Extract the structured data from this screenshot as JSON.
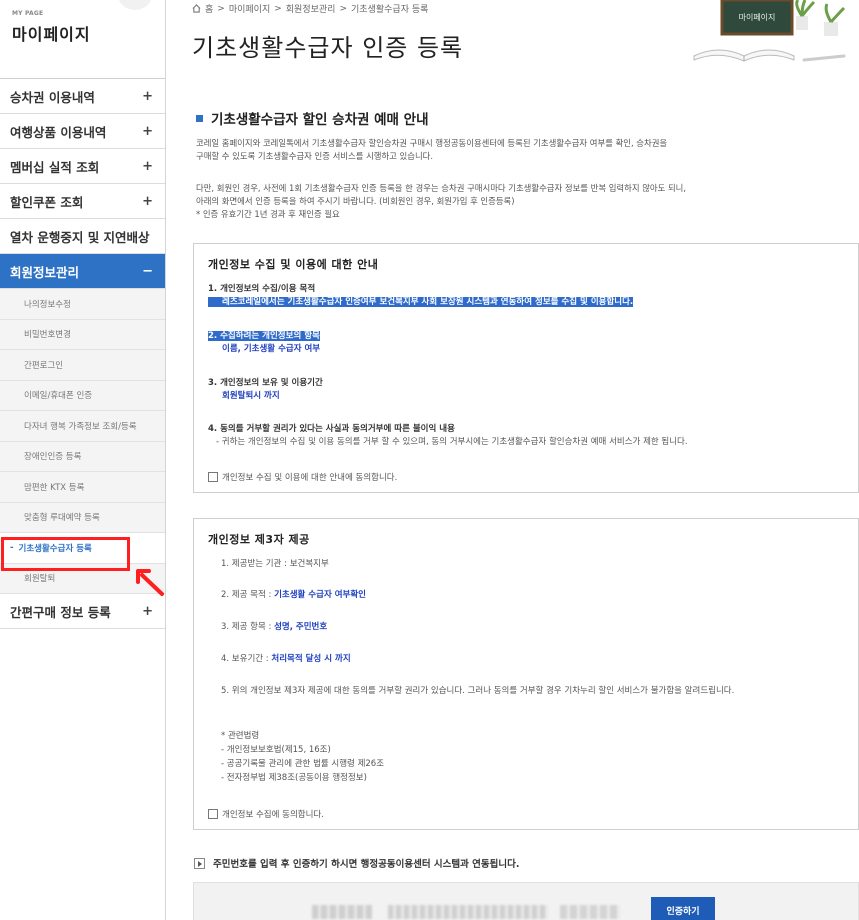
{
  "sidebar": {
    "sub": "MY PAGE",
    "title": "마이페이지",
    "menu": [
      {
        "label": "승차권 이용내역",
        "sign": "+"
      },
      {
        "label": "여행상품 이용내역",
        "sign": "+"
      },
      {
        "label": "멤버십 실적 조회",
        "sign": "+"
      },
      {
        "label": "할인쿠폰 조회",
        "sign": "+"
      },
      {
        "label": "열차 운행중지 및 지연배상",
        "sign": ""
      },
      {
        "label": "회원정보관리",
        "sign": "−"
      }
    ],
    "submenu": [
      "나의정보수정",
      "비밀번호변경",
      "간편로그인",
      "이메일/휴대폰 인증",
      "다자녀 행복 가족정보 조회/등록",
      "장애인인증 등록",
      "맘편한 KTX 등록",
      "맞춤형 루대예약 등록",
      "기초생활수급자 등록",
      "회원탈퇴"
    ],
    "current_dash": "-",
    "last_menu": {
      "label": "간편구매 정보 등록",
      "sign": "+"
    }
  },
  "breadcrumb": {
    "home_icon": "home-icon",
    "items": [
      "홈",
      ">",
      "마이페이지",
      ">",
      "회원정보관리",
      ">",
      "기초생활수급자 등록"
    ]
  },
  "page_title": "기초생활수급자 인증 등록",
  "deco_board_text": "마이페이지",
  "section": {
    "title": "기초생활수급자 할인 승차권 예매 안내",
    "intro_lines": [
      "코레일 홈페이지와 코레일톡에서 기초생활수급자 할인승차권 구매시 행정공동이용센터에 등록된 기초생활수급자 여부를 확인, 승차권을",
      "구매할 수 있도록 기초생활수급자 인증 서비스를 시행하고 있습니다.",
      "다만, 회원인 경우, 사전에 1회 기초생활수급자 인증 등록을 한 경우는 승차권 구매시마다 기초생활수급자 정보를 반복 입력하지 않아도 되니,",
      "아래의 화면에서 인증 등록을 하여 주시기 바랍니다. (비회원인 경우, 회원가입 후 인증등록)",
      "* 인증 유효기간 1년 경과 후 재인증 필요"
    ]
  },
  "box1": {
    "title": "개인정보 수집 및 이용에 대한 안내",
    "item1_h": "1. 개인정보의 수집/이용 목적",
    "item1_v": "레츠코레일에서는 기초생활수급자 인증여부 보건복지부 사회 보장원 시스템과 연동하여 정보를 수집 및 이용합니다.",
    "item2_h": "2. 수집하려는 개인정보의 항목",
    "item2_v": "이름, 기초생활 수급자 여부",
    "item3_h": "3. 개인정보의 보유 및 이용기간",
    "item3_v": "회원탈퇴시 까지",
    "item4_h": "4. 동의를 거부할 권리가 있다는 사실과 동의거부에 따른 불이익 내용",
    "item4_v": "- 귀하는 개인정보의 수집 및 이용 동의를 거부 할 수 있으며, 동의 거부시에는 기초생활수급자 할인승차권 예매 서비스가 제한 됩니다.",
    "agree": "개인정보 수집 및 이용에 대한 안내에 동의합니다."
  },
  "box2": {
    "title": "개인정보 제3자 제공",
    "l1_label": "1. 제공받는 기관 : ",
    "l1_value": "보건복지부",
    "l2_label": "2. 제공 목적 : ",
    "l2_value": "기초생활 수급자 여부확인",
    "l3_label": "3. 제공 항목 : ",
    "l3_value": "성명, 주민번호",
    "l4_label": "4. 보유기간 : ",
    "l4_value": "처리목적 달성 시 까지",
    "l5": "5. 위의 개인정보 제3자 제공에 대한 동의를 거부할 권리가 있습니다. 그러나 동의를 거부할 경우 기차누리 할인 서비스가 불가함을 알려드립니다.",
    "law_lines": [
      "* 관련법령",
      "- 개인정보보호법(제15, 16조)",
      "- 공공기록물 관리에 관한 법률 시행령 제26조",
      "- 전자정부법 제38조(공동이용 행정정보)"
    ],
    "agree": "개인정보 수집에 동의합니다."
  },
  "info_text": "주민번호를 입력 후 인증하기 하시면 행정공동이용센터 시스템과 연동됩니다.",
  "auth_button": "인증하기",
  "colors": {
    "accent": "#2e72c6",
    "highlight": "#ff1f1f",
    "button": "#1f5cb8"
  }
}
